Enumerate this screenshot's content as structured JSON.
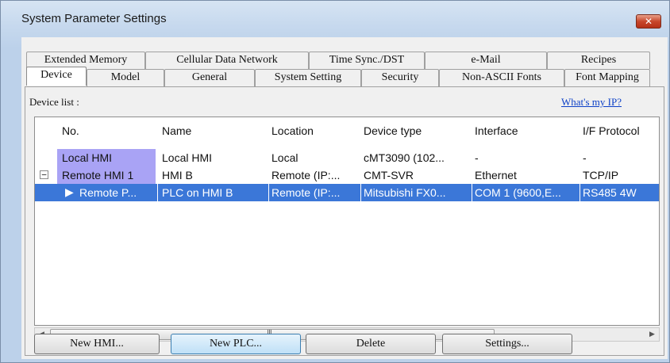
{
  "window": {
    "title": "System Parameter Settings",
    "close_glyph": "✕"
  },
  "tabs": {
    "top_row": [
      "Extended Memory",
      "Cellular Data Network",
      "Time Sync./DST",
      "e-Mail",
      "Recipes"
    ],
    "bottom_row": [
      "Device",
      "Model",
      "General",
      "System Setting",
      "Security",
      "Non-ASCII Fonts",
      "Font Mapping"
    ],
    "active": "Device"
  },
  "device_panel": {
    "list_label": "Device list :",
    "whats_my_ip": "What's my IP?",
    "columns": [
      "No.",
      "Name",
      "Location",
      "Device type",
      "Interface",
      "I/F Protocol"
    ],
    "rows": [
      {
        "no": "Local HMI",
        "name": "Local HMI",
        "location": "Local",
        "device_type": "cMT3090 (102...",
        "interface": "-",
        "protocol": "-"
      },
      {
        "no": "Remote HMI 1",
        "name": "HMI B",
        "location": "Remote (IP:...",
        "device_type": "CMT-SVR",
        "interface": "Ethernet",
        "protocol": "TCP/IP"
      },
      {
        "no": "Remote P...",
        "name": "PLC on HMI B",
        "location": "Remote (IP:...",
        "device_type": "Mitsubishi FX0...",
        "interface": "COM 1 (9600,E...",
        "protocol": "RS485 4W"
      }
    ],
    "expander_glyph": "−",
    "row_arrow_glyph": "▶",
    "scroll_grip": "III"
  },
  "buttons": {
    "new_hmi": "New HMI...",
    "new_plc": "New PLC...",
    "delete": "Delete",
    "settings": "Settings..."
  },
  "colors": {
    "selection": "#3b77d8",
    "hmi_highlight": "#a9a3f5",
    "link": "#0b3fc7"
  }
}
